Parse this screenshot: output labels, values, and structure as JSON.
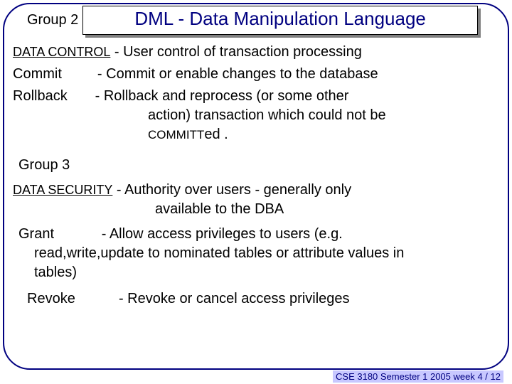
{
  "header": {
    "group2": "Group 2",
    "title": "DML - Data Manipulation Language"
  },
  "dc": {
    "label": "DATA CONTROL",
    "desc": " - User control of transaction processing",
    "commit_label": "Commit",
    "commit_desc": "-  Commit or enable changes to the database",
    "rollback_label": "Rollback",
    "rollback_desc1": "-   Rollback and reprocess (or some other",
    "rollback_desc2": "action) transaction which could not be",
    "rollback_committed": "COMMITT",
    "rollback_desc3": "ed ."
  },
  "group3": "Group 3",
  "ds": {
    "label": "DATA SECURITY",
    "desc1": " - Authority over users - generally only",
    "desc2": "available to the DBA",
    "grant_label": "Grant",
    "grant_desc1": "-  Allow access privileges to users (e.g.",
    "grant_desc2": "read,write,update to nominated tables or attribute values in",
    "grant_desc3": "tables)",
    "revoke_label": "Revoke",
    "revoke_desc": "-   Revoke or cancel access privileges"
  },
  "footer": "CSE 3180 Semester 1 2005  week 4 / 12"
}
